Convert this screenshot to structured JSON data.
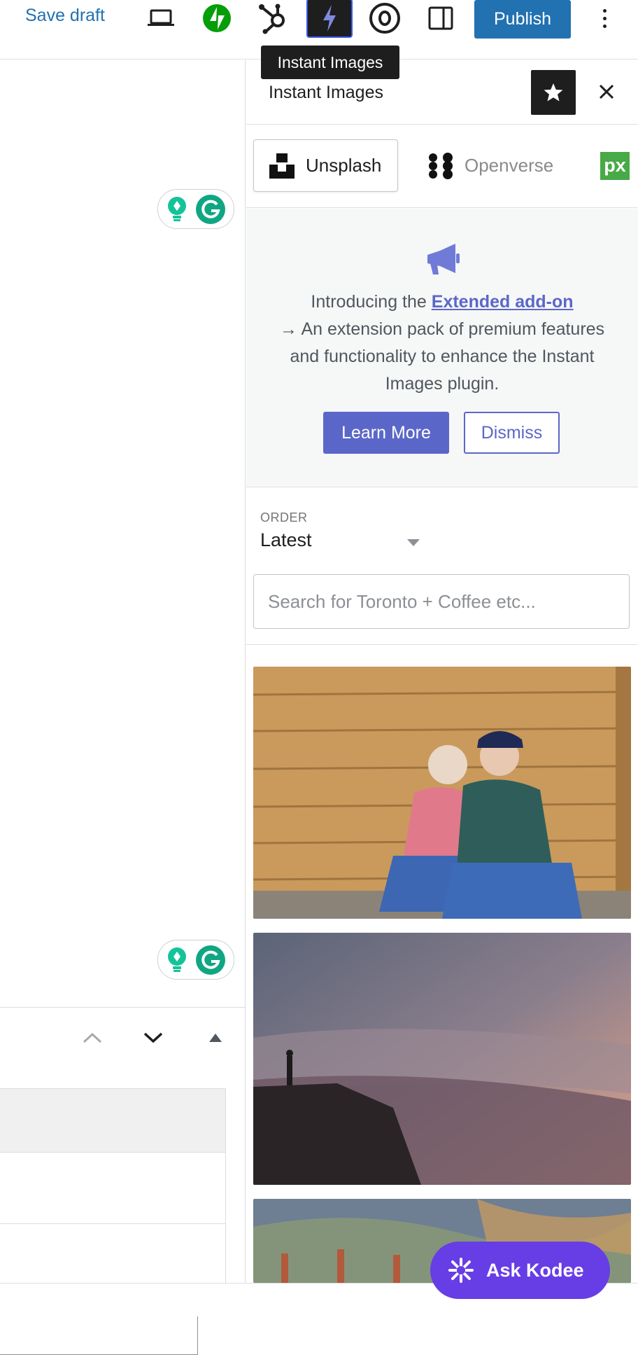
{
  "toolbar": {
    "save_draft": "Save draft",
    "publish": "Publish",
    "icons": [
      "desktop-preview-icon",
      "jetpack-icon",
      "hubspot-icon",
      "instant-images-icon",
      "yoast-icon",
      "sidebar-toggle-icon",
      "more-options-icon"
    ],
    "active_icon": "instant-images-icon"
  },
  "tooltip": "Instant Images",
  "sidebar": {
    "title": "Instant Images",
    "providers": [
      {
        "label": "Unsplash",
        "selected": true
      },
      {
        "label": "Openverse",
        "selected": false
      },
      {
        "label": "px",
        "selected": false
      }
    ],
    "notice": {
      "intro": "Introducing the ",
      "link": "Extended add-on",
      "body": "→ An extension pack of premium features and functionality to enhance the Instant Images plugin.",
      "learn_more": "Learn More",
      "dismiss": "Dismiss"
    },
    "order_label": "ORDER",
    "order_value": "Latest",
    "search_placeholder": "Search for Toronto + Coffee etc..."
  },
  "ask_kodee": "Ask Kodee",
  "colors": {
    "wp_blue": "#2271b1",
    "instant_images_accent": "#5b67c8",
    "kodee_purple": "#673de6",
    "grammarly_green": "#15c39a"
  }
}
